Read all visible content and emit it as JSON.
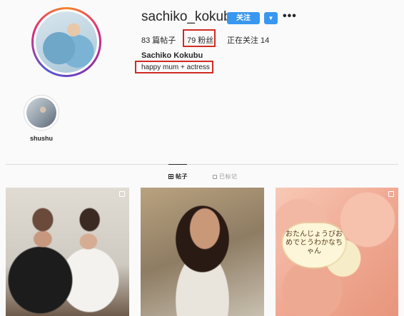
{
  "profile": {
    "username": "sachiko_kokubu",
    "follow_label": "关注",
    "dropdown_glyph": "▼",
    "more_glyph": "•••",
    "posts_count": "83 篇帖子",
    "followers_count": "79 粉丝",
    "following_count": "正在关注 14",
    "full_name": "Sachiko Kokubu",
    "bio": "happy mum + actress",
    "highlight_color": "#d12a24"
  },
  "highlights": [
    {
      "label": "shushu"
    }
  ],
  "tabs": [
    {
      "label": "帖子",
      "icon": "grid-icon",
      "active": true
    },
    {
      "label": "已标记",
      "icon": "tag-icon",
      "active": false
    }
  ],
  "posts": [
    {
      "kind": "photo",
      "multi": true
    },
    {
      "kind": "photo",
      "multi": false
    },
    {
      "kind": "photo",
      "multi": true,
      "card_text": "おたんじょうびおめでとうわかなちゃん"
    }
  ],
  "colors": {
    "accent": "#3897f0",
    "background": "#fafafa",
    "divider": "#dbdbdb"
  }
}
